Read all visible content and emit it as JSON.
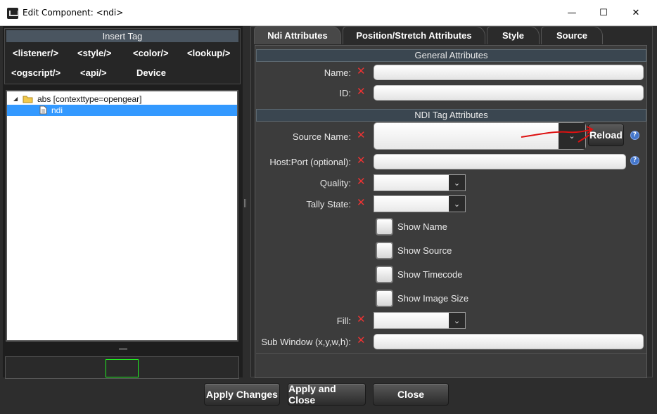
{
  "window": {
    "title": "Edit Component: <ndi>",
    "minimize": "—",
    "maximize": "☐",
    "close": "✕"
  },
  "insert_tag": {
    "header": "Insert Tag",
    "buttons": [
      "<listener/>",
      "<style/>",
      "<color/>",
      "<lookup/>",
      "<ogscript/>",
      "<api/>",
      "Device"
    ]
  },
  "tree": {
    "root_label": "abs [contexttype=opengear]",
    "child_label": "ndi"
  },
  "tabs": [
    "Ndi Attributes",
    "Position/Stretch Attributes",
    "Style",
    "Source"
  ],
  "sections": {
    "general": "General Attributes",
    "ndi": "NDI Tag Attributes"
  },
  "fields": {
    "name": {
      "label": "Name:",
      "value": ""
    },
    "id": {
      "label": "ID:",
      "value": ""
    },
    "source_name": {
      "label": "Source Name:",
      "value": ""
    },
    "reload": "Reload",
    "host_port": {
      "label": "Host:Port (optional):",
      "value": ""
    },
    "quality": {
      "label": "Quality:",
      "value": ""
    },
    "tally_state": {
      "label": "Tally State:",
      "value": ""
    },
    "fill": {
      "label": "Fill:",
      "value": ""
    },
    "sub_window": {
      "label": "Sub Window (x,y,w,h):",
      "value": ""
    }
  },
  "checkboxes": [
    {
      "label": "Show Name",
      "checked": false
    },
    {
      "label": "Show Source",
      "checked": false
    },
    {
      "label": "Show Timecode",
      "checked": false
    },
    {
      "label": "Show Image Size",
      "checked": false
    }
  ],
  "footer": {
    "apply": "Apply Changes",
    "apply_close": "Apply and Close",
    "close": "Close"
  },
  "icons": {
    "clear": "✕",
    "help": "?",
    "dropdown": "⌄"
  },
  "colors": {
    "selection": "#3399ff",
    "clear_x": "#e33333",
    "annotation": "#dd1111"
  }
}
